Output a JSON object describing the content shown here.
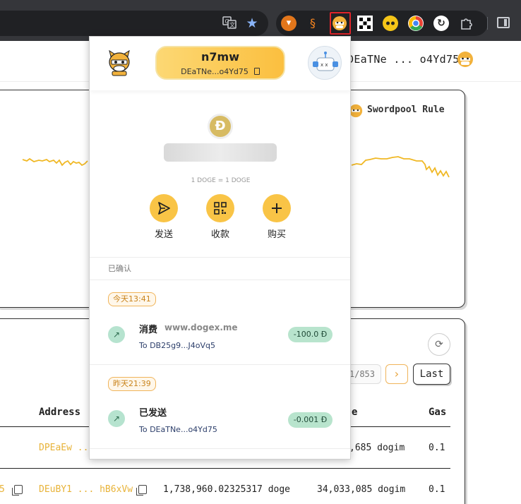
{
  "browser": {
    "toolbar_icons": [
      "translate-icon",
      "bookmark-star-icon"
    ],
    "extensions": [
      "metamask-fox-icon",
      "swirl-extension-icon",
      "dogecoin-wallet-extension-icon",
      "okx-extension-icon",
      "face-extension-icon",
      "chrome-extension-icon",
      "refresh-extension-icon",
      "puzzle-extensions-icon"
    ],
    "highlight_color": "#e0242a"
  },
  "background_page": {
    "header_address": "DEaTNe ... o4Yd75",
    "card1_title": "Swordpool Rule",
    "chart_color": "#f0b824",
    "pager_text": "1/853",
    "pager_next": "›",
    "pager_last": "Last",
    "table_headers": [
      "Address",
      "e",
      "Gas"
    ],
    "rows": [
      {
        "addr": "DPEaEw ...",
        "c3": "",
        "c4": ",685 dogim",
        "c5": "0.1"
      },
      {
        "prefix": "5",
        "addr": "DEuBY1 ... hB6xVw",
        "c3": "1,738,960.02325317 doge",
        "c4": "34,033,085 dogim",
        "c5": "0.1"
      }
    ]
  },
  "popup": {
    "account_name": "n7mw",
    "account_address": "DEaTNe...o4Yd75",
    "coin_symbol": "Ð",
    "rate_text": "1 DOGE = 1 DOGE",
    "actions": [
      {
        "label": "发送",
        "icon": "send-icon"
      },
      {
        "label": "收款",
        "icon": "qr-code-icon"
      },
      {
        "label": "购买",
        "icon": "plus-icon"
      }
    ],
    "section_label": "已确认",
    "transactions": [
      {
        "date": "今天13:41",
        "title": "消费",
        "site": "www.dogex.me",
        "to": "To DB25g9...J4oVq5",
        "amount": "-100.0 Ð"
      },
      {
        "date": "昨天21:39",
        "title": "已发送",
        "site": "",
        "to": "To DEaTNe...o4Yd75",
        "amount": "-0.001 Ð"
      }
    ],
    "accent_color": "#f9c446"
  }
}
